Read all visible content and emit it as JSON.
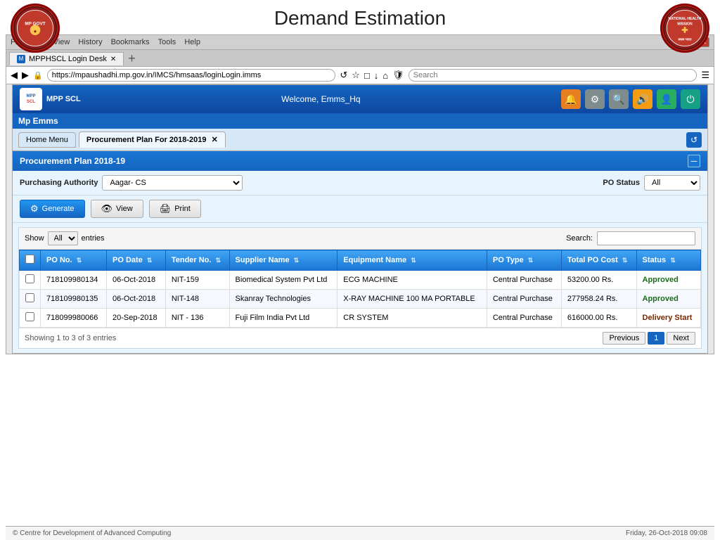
{
  "page": {
    "title": "Demand Estimation"
  },
  "logos": {
    "left_text": "MP GOVT",
    "right_text": "NHM"
  },
  "browser": {
    "menu_items": [
      "File",
      "Edit",
      "View",
      "History",
      "Bookmarks",
      "Tools",
      "Help"
    ],
    "tab_label": "MPPHSCL Login Desk",
    "url": "https://mpaushadhi.mp.gov.in/IMCS/hmsaas/loginLogin.imms",
    "search_placeholder": "Search"
  },
  "app": {
    "logo_text": "MPP SCL",
    "nav_title": "Mp Emms",
    "welcome_text": "Welcome, Emms_Hq"
  },
  "tabs": {
    "home_label": "Home Menu",
    "procurement_label": "Procurement Plan For 2018-2019"
  },
  "section": {
    "title": "Procurement Plan 2018-19"
  },
  "form": {
    "purchasing_authority_label": "Purchasing Authority",
    "purchasing_authority_value": "Aagar- CS",
    "po_status_label": "PO Status",
    "po_status_value": "All"
  },
  "buttons": {
    "generate": "Generate",
    "view": "View",
    "print": "Print"
  },
  "table": {
    "show_label": "Show",
    "entries_label": "entries",
    "search_label": "Search:",
    "show_value": "All",
    "columns": [
      "",
      "PO No.",
      "PO Date",
      "Tender No.",
      "Supplier Name",
      "Equipment Name",
      "PO Type",
      "Total PO Cost",
      "Status"
    ],
    "rows": [
      {
        "checked": false,
        "po_no": "718109980134",
        "po_date": "06-Oct-2018",
        "tender_no": "NIT-159",
        "supplier_name": "Biomedical System Pvt Ltd",
        "equipment_name": "ECG MACHINE",
        "po_type": "Central Purchase",
        "total_po_cost": "53200.00 Rs.",
        "status": "Approved",
        "status_class": "status-approved"
      },
      {
        "checked": false,
        "po_no": "718109980135",
        "po_date": "06-Oct-2018",
        "tender_no": "NIT-148",
        "supplier_name": "Skanray Technologies",
        "equipment_name": "X-RAY MACHINE 100 MA PORTABLE",
        "po_type": "Central Purchase",
        "total_po_cost": "277958.24 Rs.",
        "status": "Approved",
        "status_class": "status-approved"
      },
      {
        "checked": false,
        "po_no": "718099980066",
        "po_date": "20-Sep-2018",
        "tender_no": "NIT - 136",
        "supplier_name": "Fuji Film India Pvt Ltd",
        "equipment_name": "CR SYSTEM",
        "po_type": "Central Purchase",
        "total_po_cost": "616000.00 Rs.",
        "status": "Delivery Start",
        "status_class": "status-delivery"
      }
    ],
    "showing_text": "Showing 1 to 3 of 3 entries"
  },
  "pagination": {
    "previous": "Previous",
    "next": "Next",
    "current_page": "1"
  },
  "footer": {
    "copyright": "© Centre for Development of Advanced Computing",
    "datetime": "Friday, 26-Oct-2018 09:08"
  }
}
